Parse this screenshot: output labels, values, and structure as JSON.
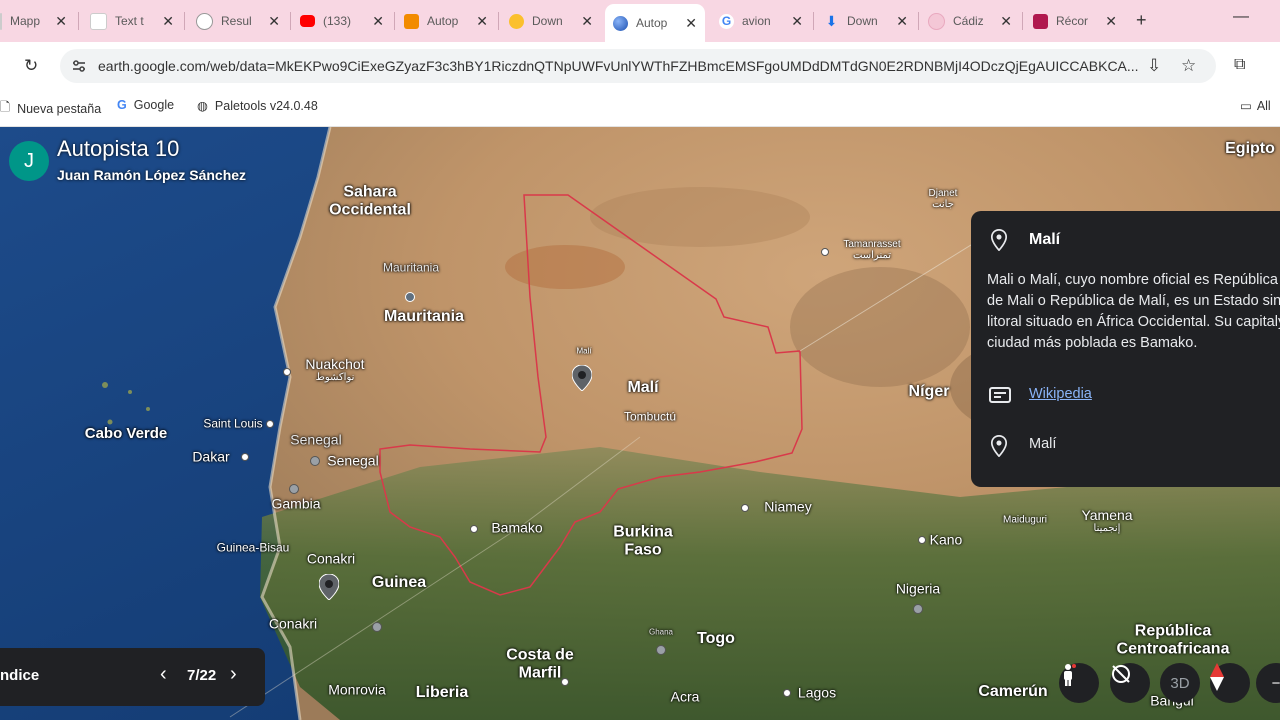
{
  "tabs": [
    {
      "title": "Mapp",
      "favicon_color": "#ffffff"
    },
    {
      "title": "Text t",
      "favicon_color": "#ffffff"
    },
    {
      "title": "Resul",
      "favicon_color": "#ffffff"
    },
    {
      "title": "(133)",
      "favicon_color": "#ff0000"
    },
    {
      "title": "Autop",
      "favicon_color": "#f28b00"
    },
    {
      "title": "Down",
      "favicon_color": "#fbc02d"
    },
    {
      "title": "Autop",
      "favicon_color": "#4285f4",
      "active": true
    },
    {
      "title": "avion",
      "favicon_color": "#ffffff"
    },
    {
      "title": "Down",
      "favicon_color": "#1a73e8"
    },
    {
      "title": "Cádiz",
      "favicon_color": "#f4c7d6"
    },
    {
      "title": "Récor",
      "favicon_color": "#b0184e"
    }
  ],
  "address_bar": {
    "url": "earth.google.com/web/data=MkEKPwo9CiExeGZyazF3c3hBY1RiczdnQTNpUWFvUnlYWThFZHBmcEMSFgoUMDdDMTdGN0E2RDNBMjI4ODczQjEgAUICCABKCA..."
  },
  "bookmarks": [
    {
      "label": "Nueva pestaña",
      "icon": "page-icon"
    },
    {
      "label": "Google",
      "icon": "google-icon"
    },
    {
      "label": "Paletools v24.0.48",
      "icon": "globe-icon"
    }
  ],
  "bookmarks_right": "All",
  "project": {
    "avatar_letter": "J",
    "title": "Autopista 10",
    "author": "Juan Ramón López Sánchez"
  },
  "map_labels": {
    "egipto": "Egipto",
    "sahara": "Sahara\nOccidental",
    "djanet": "Djanet",
    "djanet_ar": "جانت",
    "tamanrasset": "Tamanrasset",
    "tamanrasset_ar": "تمنراست",
    "mauritania_small": "Mauritania",
    "mauritania": "Mauritania",
    "nuakchot": "Nuakchot",
    "nuakchot_ar": "نواكشوط",
    "mali": "Malí",
    "mali_pin": "Malí",
    "tombuctu": "Tombuctú",
    "niger": "Níger",
    "cabo_verde": "Cabo Verde",
    "saint_louis": "Saint Louis",
    "senegal_a": "Senegal",
    "senegal_b": "Senegal",
    "dakar": "Dakar",
    "gambia": "Gambia",
    "bamako": "Bamako",
    "burkina": "Burkina\nFaso",
    "niamey": "Niamey",
    "maiduguri": "Maiduguri",
    "yamena": "Yamena",
    "yamena_ar": "إنجمينا",
    "guinea_bisau": "Guinea-Bisau",
    "conakri_a": "Conakri",
    "guinea": "Guinea",
    "kano": "Kano",
    "nigeria": "Nigeria",
    "conakri_b": "Conakri",
    "togo": "Togo",
    "ghana": "Ghana",
    "costa_marfil": "Costa de\nMarfil",
    "republica": "República\nCentroafricana",
    "monrovia": "Monrovia",
    "liberia": "Liberia",
    "acra": "Acra",
    "lagos": "Lagos",
    "camerun": "Camerún",
    "bangui": "Bangui"
  },
  "info_panel": {
    "title": "Malí",
    "description": "Mali o Malí, cuyo nombre oficial es República de Mali o República de Malí, es un Estado sin litoral situado en África Occidental. Su capitaly ciudad más poblada es Bamako.",
    "link": "Wikipedia",
    "place": "Malí"
  },
  "navigation": {
    "index_label": "ndice",
    "counter": "7/22"
  },
  "controls": {
    "three_d": "3D"
  },
  "colors": {
    "border_red": "#d9394a",
    "panel_bg": "#202124",
    "avatar": "#009688",
    "link": "#8ab4f8"
  }
}
